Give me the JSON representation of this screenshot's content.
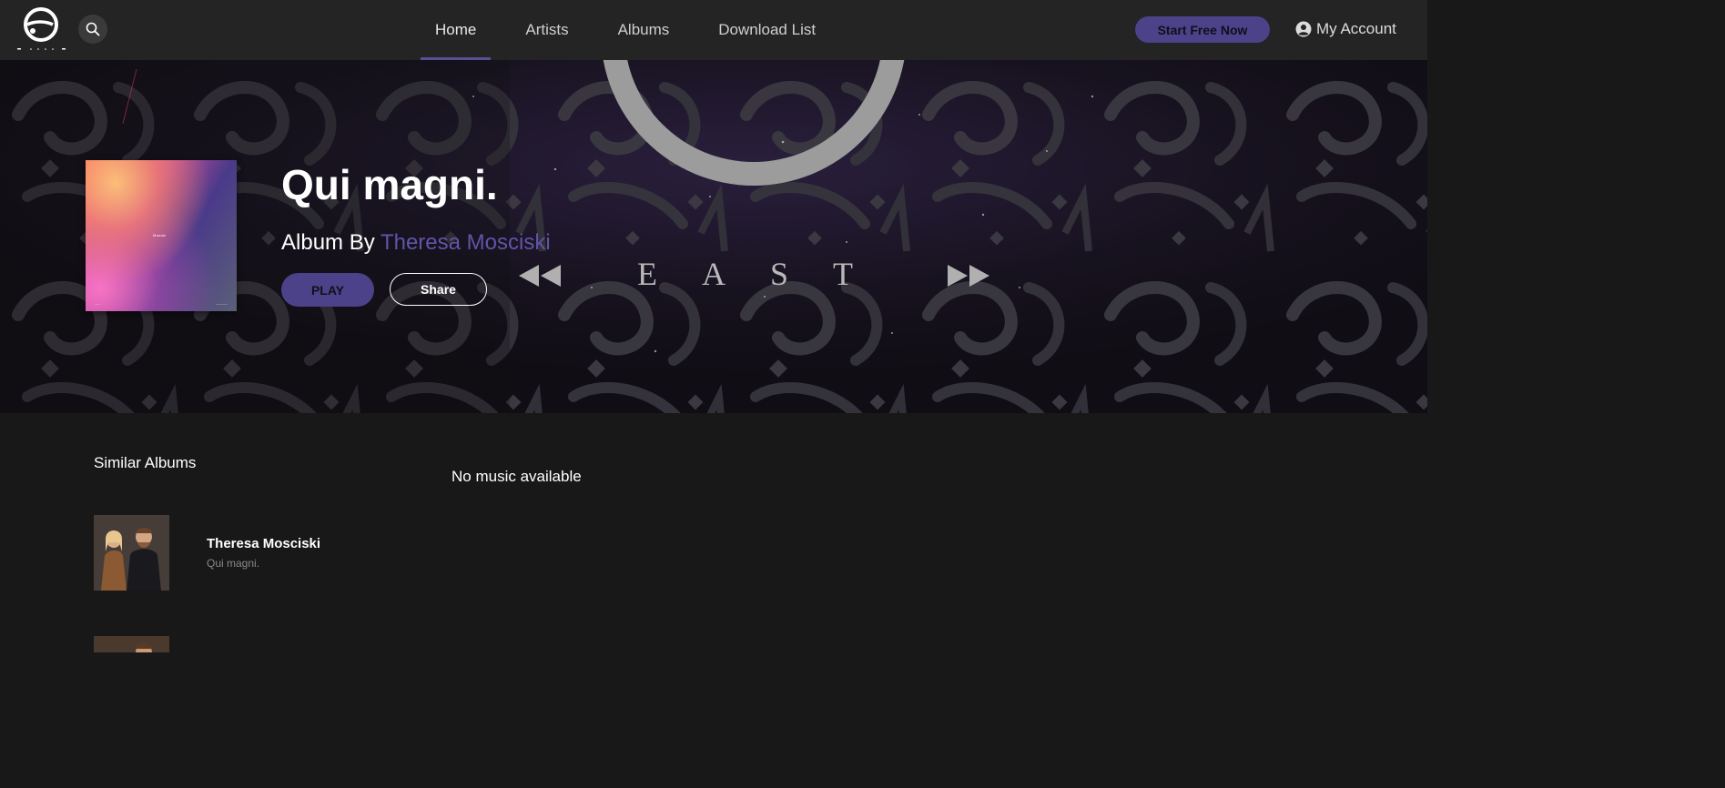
{
  "nav": {
    "logo_icon": "east-logo-icon",
    "search_icon": "search-icon",
    "items": [
      {
        "label": "Home",
        "active": true
      },
      {
        "label": "Artists",
        "active": false
      },
      {
        "label": "Albums",
        "active": false
      },
      {
        "label": "Download List",
        "active": false
      }
    ],
    "cta_label": "Start Free Now",
    "account_label": "My Account",
    "account_icon": "user-circle-icon"
  },
  "hero": {
    "album_title": "Qui magni.",
    "by_prefix": "Album By",
    "artist_name": "Theresa Mosciski",
    "play_label": "PLAY",
    "share_label": "Share",
    "banner_word": "EAST",
    "banner_icons": [
      "rewind-icon",
      "fast-forward-icon"
    ],
    "cover_text": "Mosaic",
    "accent_color": "#4b4289",
    "link_color": "#5f55a8"
  },
  "content": {
    "similar_title": "Similar Albums",
    "empty_message": "No music available",
    "similar_albums": [
      {
        "artist": "Theresa Mosciski",
        "album": "Qui magni."
      }
    ]
  }
}
